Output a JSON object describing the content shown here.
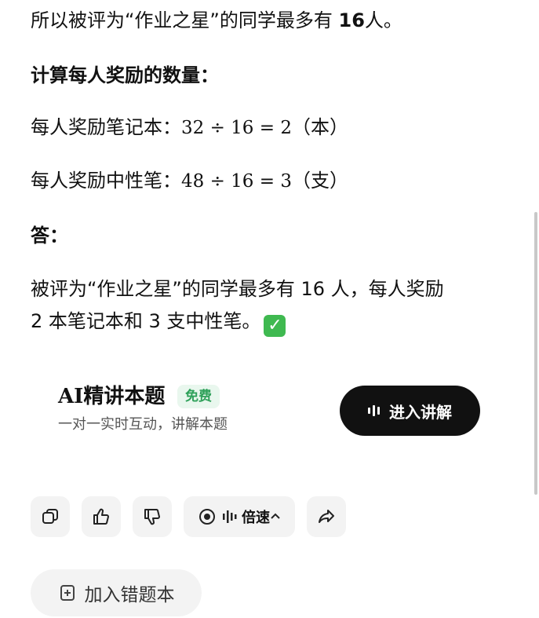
{
  "answer": {
    "line1": {
      "text": "所以被评为“作业之星”的同学最多有 ",
      "bold": "16",
      "tail": "人。"
    },
    "section_heading": "计算每人奖励的数量：",
    "notebook": {
      "label": "每人奖励笔记本：",
      "expr": "32 ÷ 16 = 2",
      "unit": "（本）"
    },
    "pen": {
      "label": "每人奖励中性笔：",
      "expr": "48 ÷ 16 = 3",
      "unit": "（支）"
    },
    "answer_heading": "答：",
    "final_line1": "被评为“作业之星”的同学最多有 16 人，每人奖励",
    "final_line2": "2 本笔记本和 3 支中性笔。",
    "check_mark": "✓"
  },
  "ai_card": {
    "title": "AI精讲本题",
    "badge": "免费",
    "subtitle": "一对一实时互动，讲解本题",
    "button_label": "进入讲解"
  },
  "actions": {
    "copy_icon": "copy-icon",
    "like_icon": "thumbs-up-icon",
    "dislike_icon": "thumbs-down-icon",
    "speed_label": "倍速",
    "share_icon": "share-icon"
  },
  "mistake_button": {
    "label": "加入错题本"
  }
}
